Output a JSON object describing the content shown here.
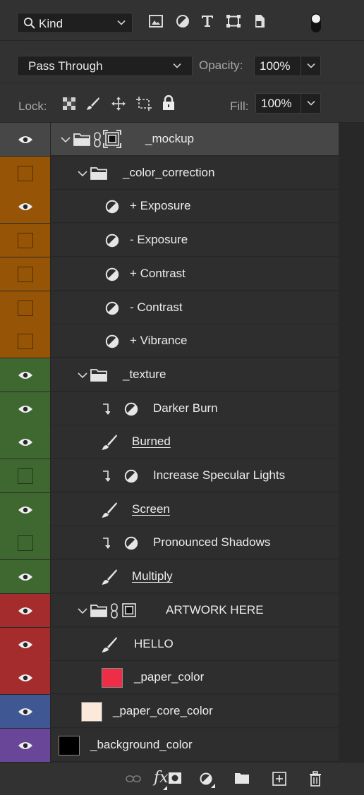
{
  "filter_bar": {
    "kind_label": "Kind",
    "icons": [
      "image-filter-icon",
      "adjustment-filter-icon",
      "type-filter-icon",
      "shape-filter-icon",
      "smart-object-filter-icon",
      "filter-toggle-icon"
    ]
  },
  "blend": {
    "mode": "Pass Through",
    "opacity_label": "Opacity:",
    "opacity_value": "100%"
  },
  "lock": {
    "label": "Lock:",
    "fill_label": "Fill:",
    "fill_value": "100%"
  },
  "layer_colors": {
    "orange": "#955406",
    "green": "#3f6730",
    "red": "#a52c2c",
    "blue": "#3f5893",
    "violet": "#6a4698"
  },
  "layers": [
    {
      "name": "_mockup",
      "type": "group-masked",
      "visible": true,
      "color": "none",
      "selected": true
    },
    {
      "name": "_color_correction",
      "type": "group",
      "visible": false,
      "color": "orange"
    },
    {
      "name": "+ Exposure",
      "type": "adjustment",
      "visible": true,
      "color": "orange"
    },
    {
      "name": "- Exposure",
      "type": "adjustment",
      "visible": false,
      "color": "orange"
    },
    {
      "name": "+ Contrast",
      "type": "adjustment",
      "visible": false,
      "color": "orange"
    },
    {
      "name": "- Contrast",
      "type": "adjustment",
      "visible": false,
      "color": "orange"
    },
    {
      "name": "+ Vibrance",
      "type": "adjustment",
      "visible": false,
      "color": "orange"
    },
    {
      "name": "_texture",
      "type": "group",
      "visible": true,
      "color": "green"
    },
    {
      "name": "Darker Burn",
      "type": "adjustment-clipped",
      "visible": true,
      "color": "green"
    },
    {
      "name": "Burned",
      "type": "brush",
      "visible": true,
      "color": "green"
    },
    {
      "name": "Increase Specular Lights",
      "type": "adjustment-clipped",
      "visible": false,
      "color": "green"
    },
    {
      "name": "Screen",
      "type": "brush",
      "visible": true,
      "color": "green"
    },
    {
      "name": "Pronounced Shadows",
      "type": "adjustment-clipped",
      "visible": false,
      "color": "green"
    },
    {
      "name": "Multiply",
      "type": "brush",
      "visible": true,
      "color": "green"
    },
    {
      "name": "ARTWORK HERE",
      "type": "group-masked",
      "visible": true,
      "color": "red"
    },
    {
      "name": "HELLO",
      "type": "brush",
      "visible": true,
      "color": "red"
    },
    {
      "name": "_paper_color",
      "type": "fill",
      "visible": true,
      "color": "red",
      "swatch": "#ee2e47"
    },
    {
      "name": "_paper_core_color",
      "type": "fill",
      "visible": true,
      "color": "blue",
      "swatch": "#fde9d9"
    },
    {
      "name": "_background_color",
      "type": "fill",
      "visible": true,
      "color": "violet",
      "swatch": "#000000"
    }
  ],
  "bottom_bar": {
    "icons": [
      "link-layers-icon",
      "fx-icon",
      "add-mask-icon",
      "new-adjustment-icon",
      "new-group-icon",
      "new-layer-icon",
      "delete-layer-icon"
    ],
    "fx_label": "fx"
  }
}
